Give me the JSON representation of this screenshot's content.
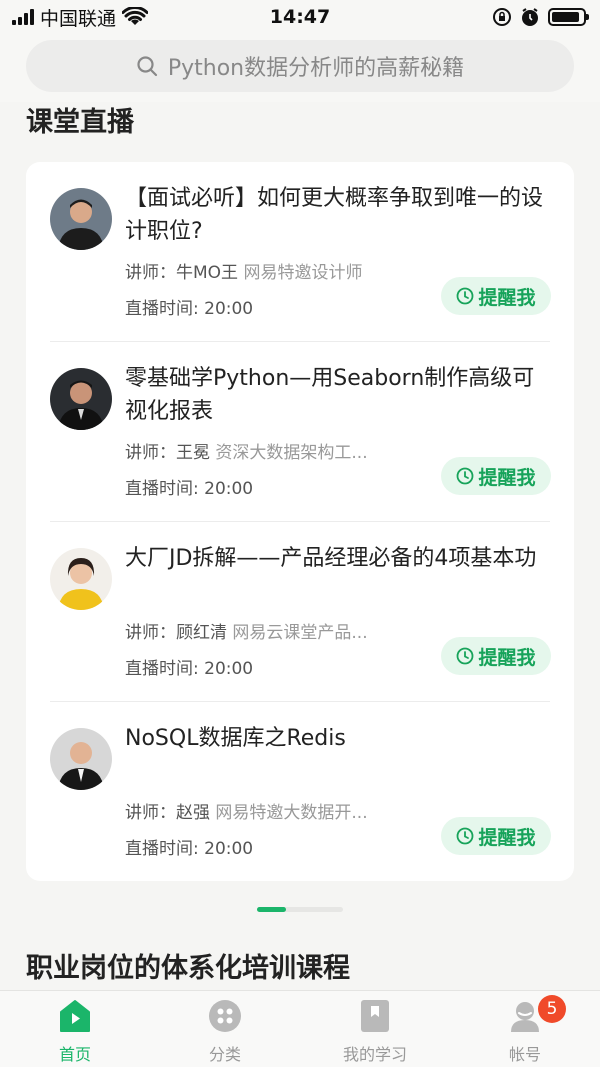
{
  "status_bar": {
    "carrier": "中国联通",
    "time": "14:47",
    "battery_level": 0.9
  },
  "search": {
    "placeholder": "Python数据分析师的高薪秘籍"
  },
  "live_section": {
    "title": "课堂直播",
    "items": [
      {
        "title": "【面试必听】如何更大概率争取到唯一的设计职位?",
        "lecturer_label": "讲师：",
        "lecturer_name": "牛MO王",
        "lecturer_desc": "网易特邀设计师",
        "time_label": "直播时间: 20:00",
        "remind_label": "提醒我"
      },
      {
        "title": "零基础学Python—用Seaborn制作高级可视化报表",
        "lecturer_label": "讲师：",
        "lecturer_name": "王冕",
        "lecturer_desc": "资深大数据架构工...",
        "time_label": "直播时间: 20:00",
        "remind_label": "提醒我"
      },
      {
        "title": "大厂JD拆解——产品经理必备的4项基本功",
        "lecturer_label": "讲师：",
        "lecturer_name": "顾红清",
        "lecturer_desc": "网易云课堂产品...",
        "time_label": "直播时间: 20:00",
        "remind_label": "提醒我"
      },
      {
        "title": "NoSQL数据库之Redis",
        "lecturer_label": "讲师：",
        "lecturer_name": "赵强",
        "lecturer_desc": "网易特邀大数据开...",
        "time_label": "直播时间: 20:00",
        "remind_label": "提醒我"
      }
    ]
  },
  "career_section": {
    "title": "职业岗位的体系化培训课程"
  },
  "tab_bar": {
    "tabs": [
      {
        "label": "首页",
        "icon": "home-play-icon",
        "active": true
      },
      {
        "label": "分类",
        "icon": "category-grid-icon",
        "active": false
      },
      {
        "label": "我的学习",
        "icon": "bookmark-book-icon",
        "active": false
      },
      {
        "label": "帐号",
        "icon": "user-icon",
        "active": false,
        "badge": "5"
      }
    ]
  },
  "colors": {
    "accent": "#1bb56a",
    "remind_bg": "#e5f7ec",
    "remind_text": "#17a35a",
    "badge": "#f04a2a"
  }
}
